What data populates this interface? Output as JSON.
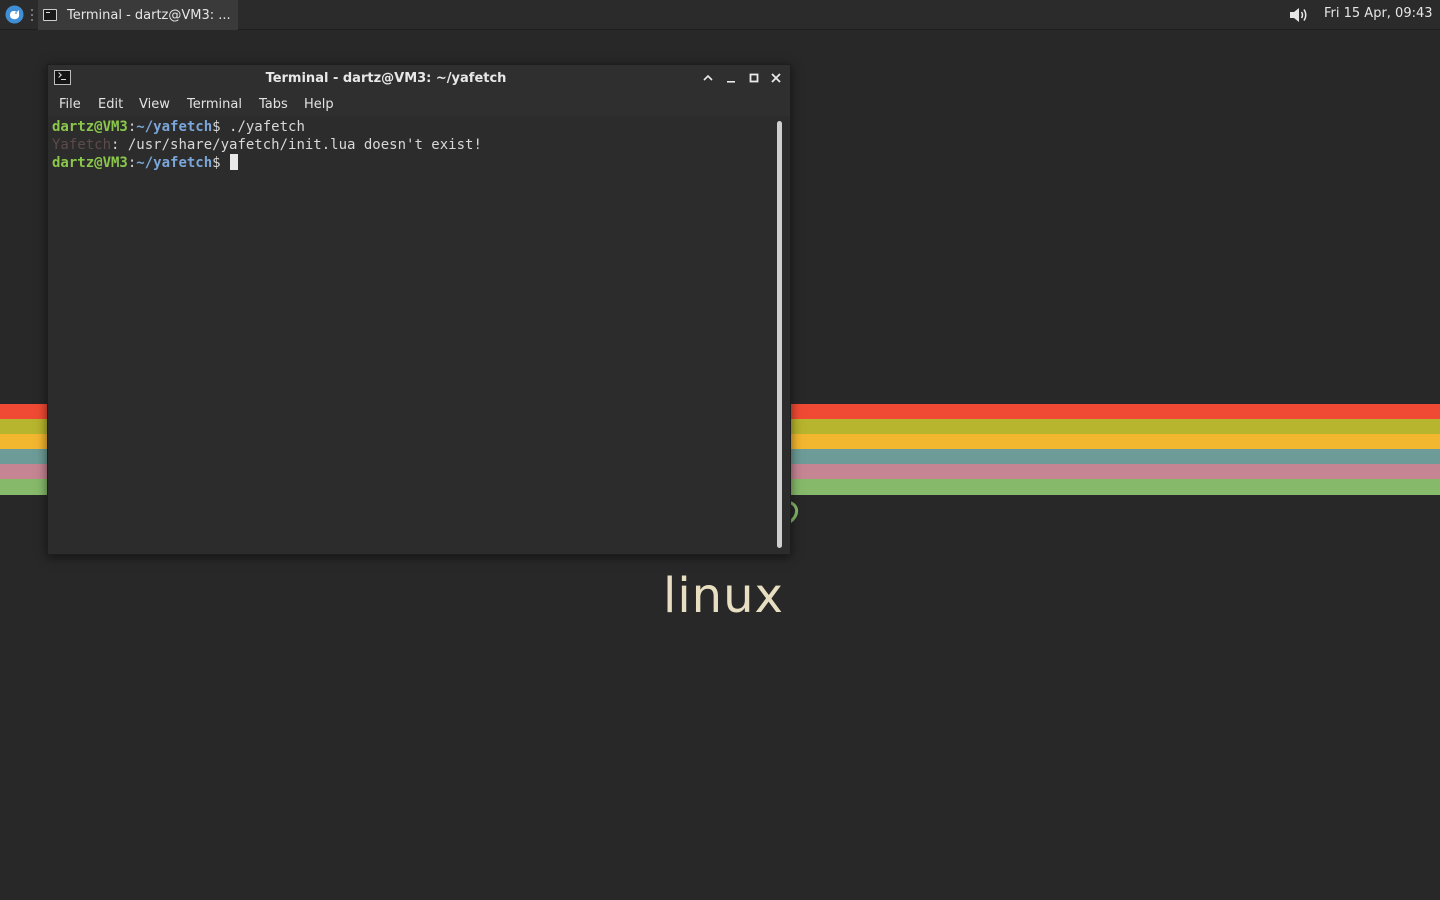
{
  "panel": {
    "menu_icon": "whisker-menu-icon",
    "task_label": "Terminal - dartz@VM3: ...",
    "task_icon": "terminal-icon",
    "volume_icon": "volume-icon",
    "clock": "Fri 15 Apr, 09:43"
  },
  "wallpaper": {
    "stripe_colors": [
      "#f04a34",
      "#b7b42d",
      "#f2b62f",
      "#6d9b97",
      "#c58593",
      "#86ba6a"
    ],
    "logo_text": "linux",
    "logo_color": "#e8dfc2"
  },
  "window": {
    "title": "Terminal - dartz@VM3: ~/yafetch",
    "icon": "terminal-icon",
    "buttons": {
      "shade": "⌃",
      "minimize": "–",
      "maximize": "□",
      "close": "✕"
    },
    "menu": [
      "File",
      "Edit",
      "View",
      "Terminal",
      "Tabs",
      "Help"
    ]
  },
  "terminal": {
    "line1": {
      "user": "dartz@VM3",
      "colon": ":",
      "path": "~/yafetch",
      "rest": "$ ./yafetch"
    },
    "line2": {
      "name": "Yafetch",
      "message": ": /usr/share/yafetch/init.lua doesn't exist!"
    },
    "line3": {
      "user": "dartz@VM3",
      "colon": ":",
      "path": "~/yafetch",
      "rest": "$ "
    },
    "colors": {
      "prompt_user": "#8ac74a",
      "prompt_path": "#7aa6d9",
      "text": "#d8d8d8"
    }
  }
}
